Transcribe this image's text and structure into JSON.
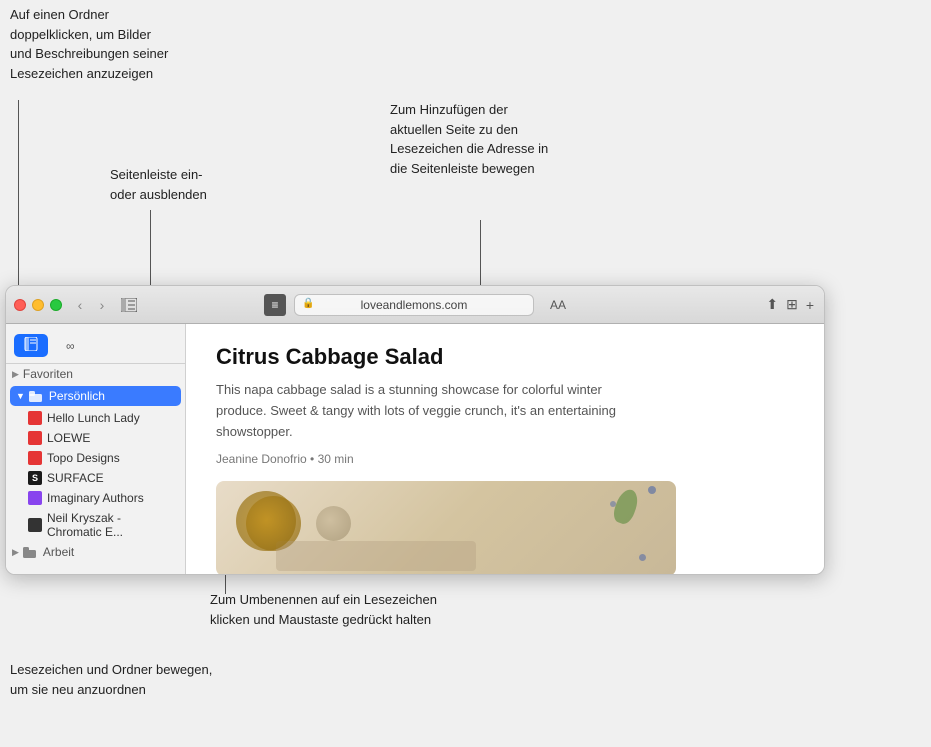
{
  "annotations": {
    "top_left": "Auf einen Ordner\ndoppelklicken, um Bilder\nund Beschreibungen seiner\nLesezeichen anzuzeigen",
    "top_center": "Seitenleiste ein-\noder ausblenden",
    "top_right": "Zum Hinzufügen der\naktuellen Seite zu den\nLesezeichen die Adresse in\ndie Seitenleiste bewegen",
    "bottom_center": "Zum Umbenennen auf ein Lesezeichen\nklicken und Maustaste gedrückt halten",
    "bottom_left": "Lesezeichen und Ordner bewegen,\num sie neu anzuordnen"
  },
  "browser": {
    "address": "loveandlemons.com",
    "reader_icon": "≡",
    "aa_label": "AA"
  },
  "sidebar": {
    "active_tab": "bookmarks",
    "tab_icons": [
      "🔖",
      "∞"
    ],
    "groups": [
      {
        "label": "Favoriten",
        "expanded": false,
        "indent": 0
      },
      {
        "label": "Persönlich",
        "expanded": true,
        "selected": true,
        "indent": 0
      }
    ],
    "bookmarks": [
      {
        "label": "Hello Lunch Lady",
        "color": "red"
      },
      {
        "label": "LOEWE",
        "color": "red"
      },
      {
        "label": "Topo Designs",
        "color": "red"
      },
      {
        "label": "SURFACE",
        "letter": "S",
        "bg": "#1a1a1a"
      },
      {
        "label": "Imaginary Authors",
        "color": "purple"
      },
      {
        "label": "Neil Kryszak - Chromatic E...",
        "color": "dark"
      }
    ],
    "bottom_group": {
      "label": "Arbeit",
      "expanded": false
    }
  },
  "article": {
    "title": "Citrus Cabbage Salad",
    "description": "This napa cabbage salad is a stunning showcase for colorful winter produce. Sweet & tangy with lots of veggie crunch, it's an entertaining showstopper.",
    "meta": "Jeanine Donofrio • 30 min"
  }
}
